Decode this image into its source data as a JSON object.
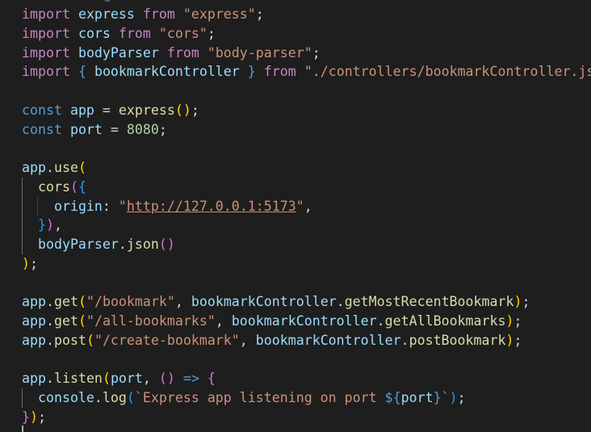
{
  "editor": {
    "language": "javascript",
    "indent_unit": "  ",
    "colors": {
      "background": "#1e1e1e",
      "default": "#d4d4d4",
      "keyword_control": "#c586c0",
      "keyword_declaration": "#569cd6",
      "identifier": "#9cdcfe",
      "function": "#dcdcaa",
      "string": "#ce9178",
      "number": "#b5cea8",
      "bracket_level_1": "#ffd700",
      "bracket_level_2": "#da70d6",
      "bracket_level_3": "#179fff",
      "indent_guide": "#404040",
      "indent_guide_active": "#707070"
    },
    "lines": [
      {
        "indent": 0,
        "tokens": [
          {
            "t": "import",
            "c": "k-control"
          },
          {
            "t": " "
          },
          {
            "t": "express",
            "c": "ident"
          },
          {
            "t": " "
          },
          {
            "t": "from",
            "c": "k-control"
          },
          {
            "t": " "
          },
          {
            "t": "\"express\"",
            "c": "str"
          },
          {
            "t": ";",
            "c": "punct"
          }
        ]
      },
      {
        "indent": 0,
        "tokens": [
          {
            "t": "import",
            "c": "k-control"
          },
          {
            "t": " "
          },
          {
            "t": "cors",
            "c": "ident"
          },
          {
            "t": " "
          },
          {
            "t": "from",
            "c": "k-control"
          },
          {
            "t": " "
          },
          {
            "t": "\"cors\"",
            "c": "str"
          },
          {
            "t": ";",
            "c": "punct"
          }
        ]
      },
      {
        "indent": 0,
        "tokens": [
          {
            "t": "import",
            "c": "k-control"
          },
          {
            "t": " "
          },
          {
            "t": "bodyParser",
            "c": "ident"
          },
          {
            "t": " "
          },
          {
            "t": "from",
            "c": "k-control"
          },
          {
            "t": " "
          },
          {
            "t": "\"body-parser\"",
            "c": "str"
          },
          {
            "t": ";",
            "c": "punct"
          }
        ]
      },
      {
        "indent": 0,
        "tokens": [
          {
            "t": "import",
            "c": "k-control"
          },
          {
            "t": " "
          },
          {
            "t": "{",
            "c": "k-decl"
          },
          {
            "t": " "
          },
          {
            "t": "bookmarkController",
            "c": "ident"
          },
          {
            "t": " "
          },
          {
            "t": "}",
            "c": "k-decl"
          },
          {
            "t": " "
          },
          {
            "t": "from",
            "c": "k-control"
          },
          {
            "t": " "
          },
          {
            "t": "\"./controllers/bookmarkController.js\"",
            "c": "str"
          },
          {
            "t": ";",
            "c": "punct"
          }
        ]
      },
      {
        "indent": 0,
        "tokens": []
      },
      {
        "indent": 0,
        "tokens": [
          {
            "t": "const",
            "c": "k-decl"
          },
          {
            "t": " "
          },
          {
            "t": "app",
            "c": "ident"
          },
          {
            "t": " = ",
            "c": "punct"
          },
          {
            "t": "express",
            "c": "func"
          },
          {
            "t": "()",
            "c": "b1"
          },
          {
            "t": ";",
            "c": "punct"
          }
        ]
      },
      {
        "indent": 0,
        "tokens": [
          {
            "t": "const",
            "c": "k-decl"
          },
          {
            "t": " "
          },
          {
            "t": "port",
            "c": "ident"
          },
          {
            "t": " = ",
            "c": "punct"
          },
          {
            "t": "8080",
            "c": "num"
          },
          {
            "t": ";",
            "c": "punct"
          }
        ]
      },
      {
        "indent": 0,
        "tokens": []
      },
      {
        "indent": 0,
        "tokens": [
          {
            "t": "app",
            "c": "ident"
          },
          {
            "t": ".",
            "c": "punct"
          },
          {
            "t": "use",
            "c": "func"
          },
          {
            "t": "(",
            "c": "b1"
          }
        ]
      },
      {
        "indent": 1,
        "tokens": [
          {
            "t": "cors",
            "c": "func"
          },
          {
            "t": "(",
            "c": "b2"
          },
          {
            "t": "{",
            "c": "b3"
          }
        ]
      },
      {
        "indent": 2,
        "tokens": [
          {
            "t": "origin",
            "c": "ident"
          },
          {
            "t": ": ",
            "c": "punct"
          },
          {
            "t": "\"",
            "c": "str"
          },
          {
            "t": "http://127.0.0.1:5173",
            "c": "str url"
          },
          {
            "t": "\"",
            "c": "str"
          },
          {
            "t": ",",
            "c": "punct"
          }
        ]
      },
      {
        "indent": 1,
        "tokens": [
          {
            "t": "}",
            "c": "b3"
          },
          {
            "t": ")",
            "c": "b2"
          },
          {
            "t": ",",
            "c": "punct"
          }
        ]
      },
      {
        "indent": 1,
        "tokens": [
          {
            "t": "bodyParser",
            "c": "ident"
          },
          {
            "t": ".",
            "c": "punct"
          },
          {
            "t": "json",
            "c": "func"
          },
          {
            "t": "()",
            "c": "b2"
          }
        ]
      },
      {
        "indent": 0,
        "tokens": [
          {
            "t": ")",
            "c": "b1"
          },
          {
            "t": ";",
            "c": "punct"
          }
        ]
      },
      {
        "indent": 0,
        "tokens": []
      },
      {
        "indent": 0,
        "tokens": [
          {
            "t": "app",
            "c": "ident"
          },
          {
            "t": ".",
            "c": "punct"
          },
          {
            "t": "get",
            "c": "func"
          },
          {
            "t": "(",
            "c": "b1"
          },
          {
            "t": "\"/bookmark\"",
            "c": "str"
          },
          {
            "t": ", ",
            "c": "punct"
          },
          {
            "t": "bookmarkController",
            "c": "ident"
          },
          {
            "t": ".",
            "c": "punct"
          },
          {
            "t": "getMostRecentBookmark",
            "c": "func"
          },
          {
            "t": ")",
            "c": "b1"
          },
          {
            "t": ";",
            "c": "punct"
          }
        ]
      },
      {
        "indent": 0,
        "tokens": [
          {
            "t": "app",
            "c": "ident"
          },
          {
            "t": ".",
            "c": "punct"
          },
          {
            "t": "get",
            "c": "func"
          },
          {
            "t": "(",
            "c": "b1"
          },
          {
            "t": "\"/all-bookmarks\"",
            "c": "str"
          },
          {
            "t": ", ",
            "c": "punct"
          },
          {
            "t": "bookmarkController",
            "c": "ident"
          },
          {
            "t": ".",
            "c": "punct"
          },
          {
            "t": "getAllBookmarks",
            "c": "func"
          },
          {
            "t": ")",
            "c": "b1"
          },
          {
            "t": ";",
            "c": "punct"
          }
        ]
      },
      {
        "indent": 0,
        "tokens": [
          {
            "t": "app",
            "c": "ident"
          },
          {
            "t": ".",
            "c": "punct"
          },
          {
            "t": "post",
            "c": "func"
          },
          {
            "t": "(",
            "c": "b1"
          },
          {
            "t": "\"/create-bookmark\"",
            "c": "str"
          },
          {
            "t": ", ",
            "c": "punct"
          },
          {
            "t": "bookmarkController",
            "c": "ident"
          },
          {
            "t": ".",
            "c": "punct"
          },
          {
            "t": "postBookmark",
            "c": "func"
          },
          {
            "t": ")",
            "c": "b1"
          },
          {
            "t": ";",
            "c": "punct"
          }
        ]
      },
      {
        "indent": 0,
        "tokens": []
      },
      {
        "indent": 0,
        "tokens": [
          {
            "t": "app",
            "c": "ident"
          },
          {
            "t": ".",
            "c": "punct"
          },
          {
            "t": "listen",
            "c": "func"
          },
          {
            "t": "(",
            "c": "b1"
          },
          {
            "t": "port",
            "c": "ident"
          },
          {
            "t": ", ",
            "c": "punct"
          },
          {
            "t": "()",
            "c": "b2"
          },
          {
            "t": " => ",
            "c": "k-decl"
          },
          {
            "t": "{",
            "c": "b2"
          }
        ]
      },
      {
        "indent": 1,
        "tokens": [
          {
            "t": "console",
            "c": "ident"
          },
          {
            "t": ".",
            "c": "punct"
          },
          {
            "t": "log",
            "c": "func"
          },
          {
            "t": "(",
            "c": "b3"
          },
          {
            "t": "`Express app listening on port ",
            "c": "str"
          },
          {
            "t": "${",
            "c": "k-decl"
          },
          {
            "t": "port",
            "c": "ident"
          },
          {
            "t": "}",
            "c": "k-decl"
          },
          {
            "t": "`",
            "c": "str"
          },
          {
            "t": ")",
            "c": "b3"
          },
          {
            "t": ";",
            "c": "punct"
          }
        ]
      },
      {
        "indent": 0,
        "tokens": [
          {
            "t": "}",
            "c": "b2"
          },
          {
            "t": ")",
            "c": "b1"
          },
          {
            "t": ";",
            "c": "punct"
          }
        ]
      }
    ]
  }
}
